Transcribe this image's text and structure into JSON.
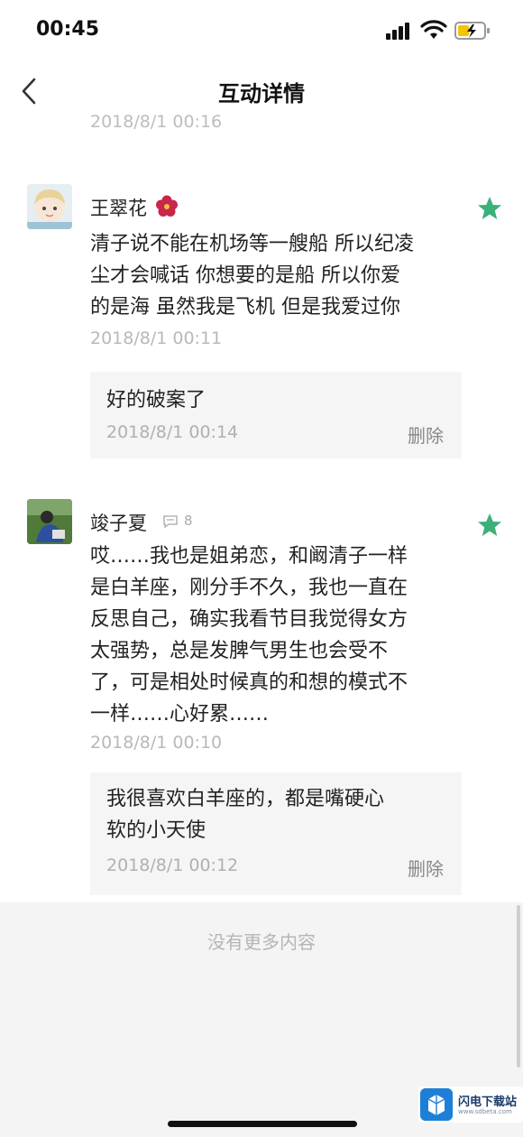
{
  "status_bar": {
    "time": "00:45"
  },
  "nav": {
    "title": "互动详情"
  },
  "cut_off_timestamp": "2018/8/1 00:16",
  "comments": [
    {
      "username": "王翠花",
      "text_lines": [
        "清子说不能在机场等一艘船 所以纪凌",
        "尘才会喊话 你想要的是船 所以你爱",
        "的是海 虽然我是飞机 但是我爱过你"
      ],
      "timestamp": "2018/8/1 00:11",
      "reply": {
        "text_lines": [
          "好的破案了"
        ],
        "timestamp": "2018/8/1 00:14",
        "delete_label": "删除"
      }
    },
    {
      "username": "竣子夏",
      "reply_count": "8",
      "text_lines": [
        "哎……我也是姐弟恋，和阚清子一样",
        "是白羊座，刚分手不久，我也一直在",
        "反思自己，确实我看节目我觉得女方",
        "太强势，总是发脾气男生也会受不",
        "了，可是相处时候真的和想的模式不",
        "一样……心好累……"
      ],
      "timestamp": "2018/8/1 00:10",
      "reply": {
        "text_lines": [
          "我很喜欢白羊座的，都是嘴硬心",
          "软的小天使"
        ],
        "timestamp": "2018/8/1 00:12",
        "delete_label": "删除"
      }
    }
  ],
  "footer": {
    "no_more": "没有更多内容"
  },
  "watermark": {
    "name": "闪电下载站",
    "url": "www.sdbeta.com"
  },
  "colors": {
    "star": "#3db07a",
    "reply_bg": "#f5f5f5",
    "footer_bg": "#f4f4f4"
  }
}
